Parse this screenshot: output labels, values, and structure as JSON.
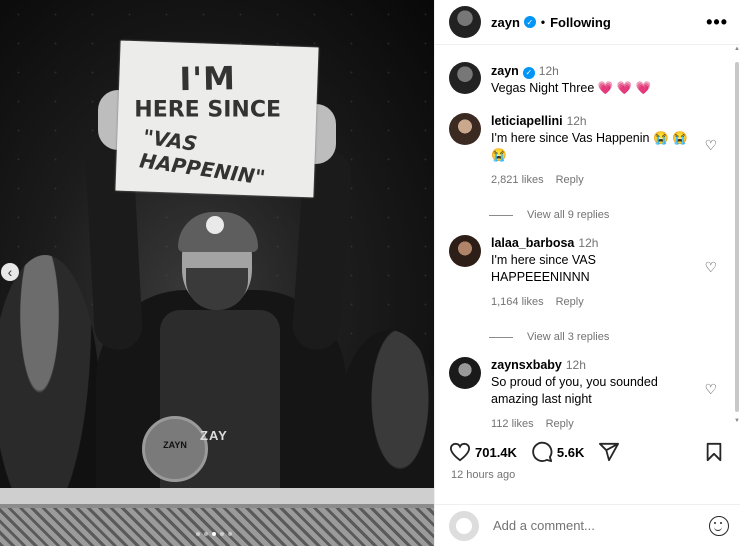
{
  "photo": {
    "sign_lines": [
      "I'M",
      "HERE SINCE",
      "\"VAS HAPPENIN\""
    ],
    "shirt_text": "ZAY",
    "medal_text": "ZAYN"
  },
  "header": {
    "username": "zayn",
    "separator": "•",
    "follow_status": "Following",
    "more": "•••"
  },
  "caption": {
    "username": "zayn",
    "time": "12h",
    "text": "Vegas Night Three",
    "emoji": "💗 💗 💗"
  },
  "comments": [
    {
      "username": "leticiapellini",
      "time": "12h",
      "text": "I'm here since Vas Happenin 😭 😭 😭",
      "likes": "2,821 likes",
      "reply_label": "Reply",
      "view_replies": "View all 9 replies"
    },
    {
      "username": "lalaa_barbosa",
      "time": "12h",
      "text": "I'm here since VAS HAPPEEENINNN",
      "likes": "1,164 likes",
      "reply_label": "Reply",
      "view_replies": "View all 3 replies"
    },
    {
      "username": "zaynsxbaby",
      "time": "12h",
      "text": "So proud of you, you sounded amazing last night",
      "likes": "112 likes",
      "reply_label": "Reply"
    }
  ],
  "actions": {
    "likes": "701.4K",
    "comments": "5.6K"
  },
  "time_ago": "12 hours ago",
  "add_comment": {
    "placeholder": "Add a comment..."
  },
  "colors": {
    "verified": "#0095f6",
    "muted": "#737373"
  }
}
